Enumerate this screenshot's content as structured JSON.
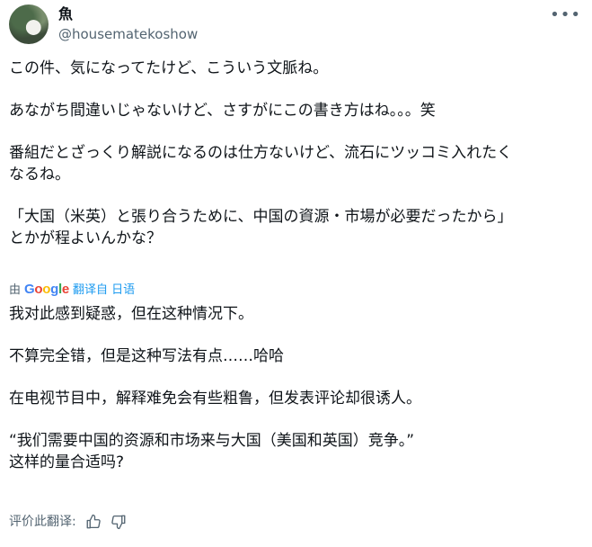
{
  "author": {
    "name": "魚",
    "handle": "@housematekoshow"
  },
  "original_paragraphs": [
    "この件、気になってたけど、こういう文脈ね。",
    "あながち間違いじゃないけど、さすがにこの書き方はね。。。笑",
    "番組だとざっくり解説になるのは仕方ないけど、流石にツッコミ入れたく\nなるね。",
    "「大国（米英）と張り合うために、中国の資源・市場が必要だったから」\nとかが程よいんかな？"
  ],
  "translation_bar": {
    "prefix": "由",
    "logo_letters": [
      "G",
      "o",
      "o",
      "g",
      "l",
      "e"
    ],
    "logo_colors": [
      "#4285F4",
      "#EA4335",
      "#FBBC05",
      "#4285F4",
      "#34A853",
      "#EA4335"
    ],
    "link_text": "翻译自 日语"
  },
  "translated_paragraphs": [
    "我对此感到疑惑，但在这种情况下。",
    "不算完全错，但是这种写法有点……哈哈",
    "在电视节目中，解释难免会有些粗鲁，但发表评论却很诱人。",
    "“我们需要中国的资源和市场来与大国（美国和英国）竞争。”\n这样的量合适吗?"
  ],
  "rating": {
    "label": "评价此翻译:",
    "icons": [
      "thumbs-up-icon",
      "thumbs-down-icon"
    ]
  },
  "colors": {
    "link": "#1d9bf0",
    "secondary": "#536471"
  }
}
